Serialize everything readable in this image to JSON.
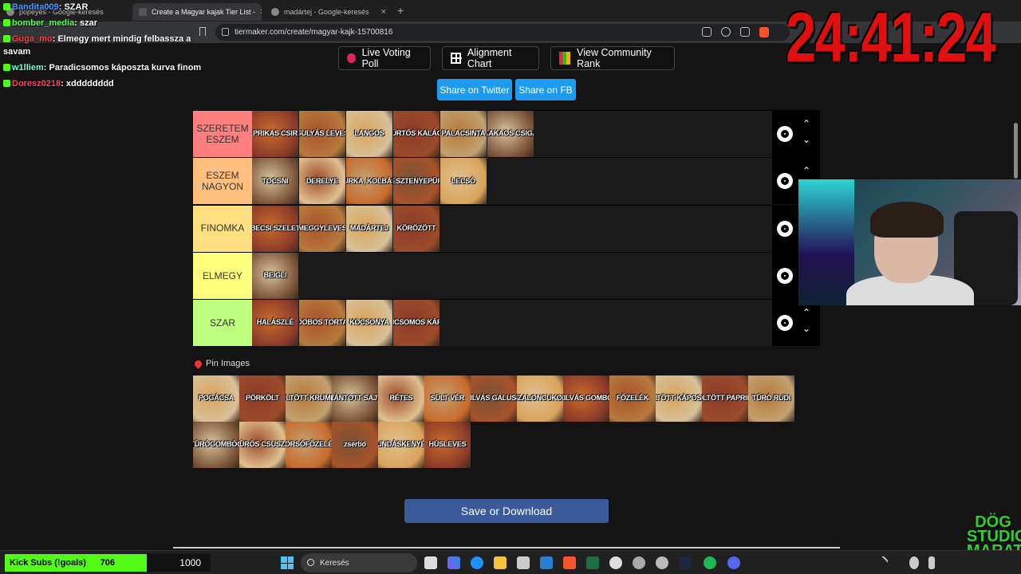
{
  "tabs": [
    {
      "label": "popeyes - Google-keresés",
      "active": false
    },
    {
      "label": "Create a Magyar kajak Tier List - ",
      "active": true
    },
    {
      "label": "madártej - Google-keresés",
      "active": false
    }
  ],
  "address": "tiermaker.com/create/magyar-kajk-15700816",
  "top_buttons": {
    "live_poll": "Live Voting Poll",
    "alignment": "Alignment Chart",
    "community": "View Community Rank"
  },
  "share": {
    "twitter": "Share on Twitter",
    "fb": "Share on FB"
  },
  "tiers": [
    {
      "label": "SZERETEM ESZEM",
      "color": "#ff7f7f",
      "items": [
        "PRIKAS CSIR",
        "GULYÁS LEVES",
        "LANGOS",
        "KÜRTŐS KALÁCS",
        "PALACSINTA",
        "KAKAOS CSIGA"
      ]
    },
    {
      "label": "ESZEM NAGYON",
      "color": "#ffbf7f",
      "items": [
        "TOCSNI",
        "DERELYE",
        "HURKA, KOLBÁSZ",
        "GESZTENYEPÜRÉ",
        "LECSÓ"
      ]
    },
    {
      "label": "FINOMKA",
      "color": "#ffdf7f",
      "items": [
        "BECSI SZELET",
        "MEGGYLEVES",
        "MADÁRTEJ",
        "KÖRÖZÖTT"
      ]
    },
    {
      "label": "ELMEGY",
      "color": "#ffff7f",
      "items": [
        "BEIGLI"
      ]
    },
    {
      "label": "SZAR",
      "color": "#bfff7f",
      "items": [
        "HALÁSZLÉ",
        "DOBOS TORTA",
        "KOCSONYA",
        "PARADICSOMOS KÁPOSZTA"
      ]
    }
  ],
  "pin_label": "Pin Images",
  "pool": [
    "POGÁCSA",
    "PÖRKÖLT",
    "TÖLTÖTT KRUMPLI",
    "RÁNTOTT SAJT",
    "RÉTES",
    "SÜLT VÉR",
    "SZILVÁS GALUSKA",
    "SZALONCUKOR",
    "SZILVÁS GOMBÓC",
    "FŐZELÉK",
    "TÖLTÖTT KÁPOSZTA",
    "TÖLTÖTT PAPRIKA",
    "TÚRÓ RUDI",
    "TÚRÓGOMBÓC",
    "TÚRÓS CSUSZA",
    "BORSÓFŐZELÉK",
    "zserbó",
    "PUNDÁSKENYÉR",
    "HÚSLEVES"
  ],
  "save_label": "Save or Download",
  "chat": [
    {
      "user": "Bandita009",
      "user_color": "#4a9bff",
      "text": "SZAR"
    },
    {
      "user": "bomber_media",
      "user_color": "#5cff5c",
      "text": "szar"
    },
    {
      "user": "Guga_mo",
      "user_color": "#ff4040",
      "text": "Elmegy mert mindig felbassza a savam"
    },
    {
      "user": "w1lliem",
      "user_color": "#7fffd4",
      "text": "Paradicsomos káposzta kurva finom"
    },
    {
      "user": "Doresz0218",
      "user_color": "#ff4060",
      "text": "xdddddddd"
    }
  ],
  "timer": "24:41:24",
  "kick": {
    "label": "Kick Subs (!goals)",
    "count": "706",
    "goal": "1000"
  },
  "taskbar_search": "Keresés",
  "logo_text": "DÖG STUDIO MARATON"
}
